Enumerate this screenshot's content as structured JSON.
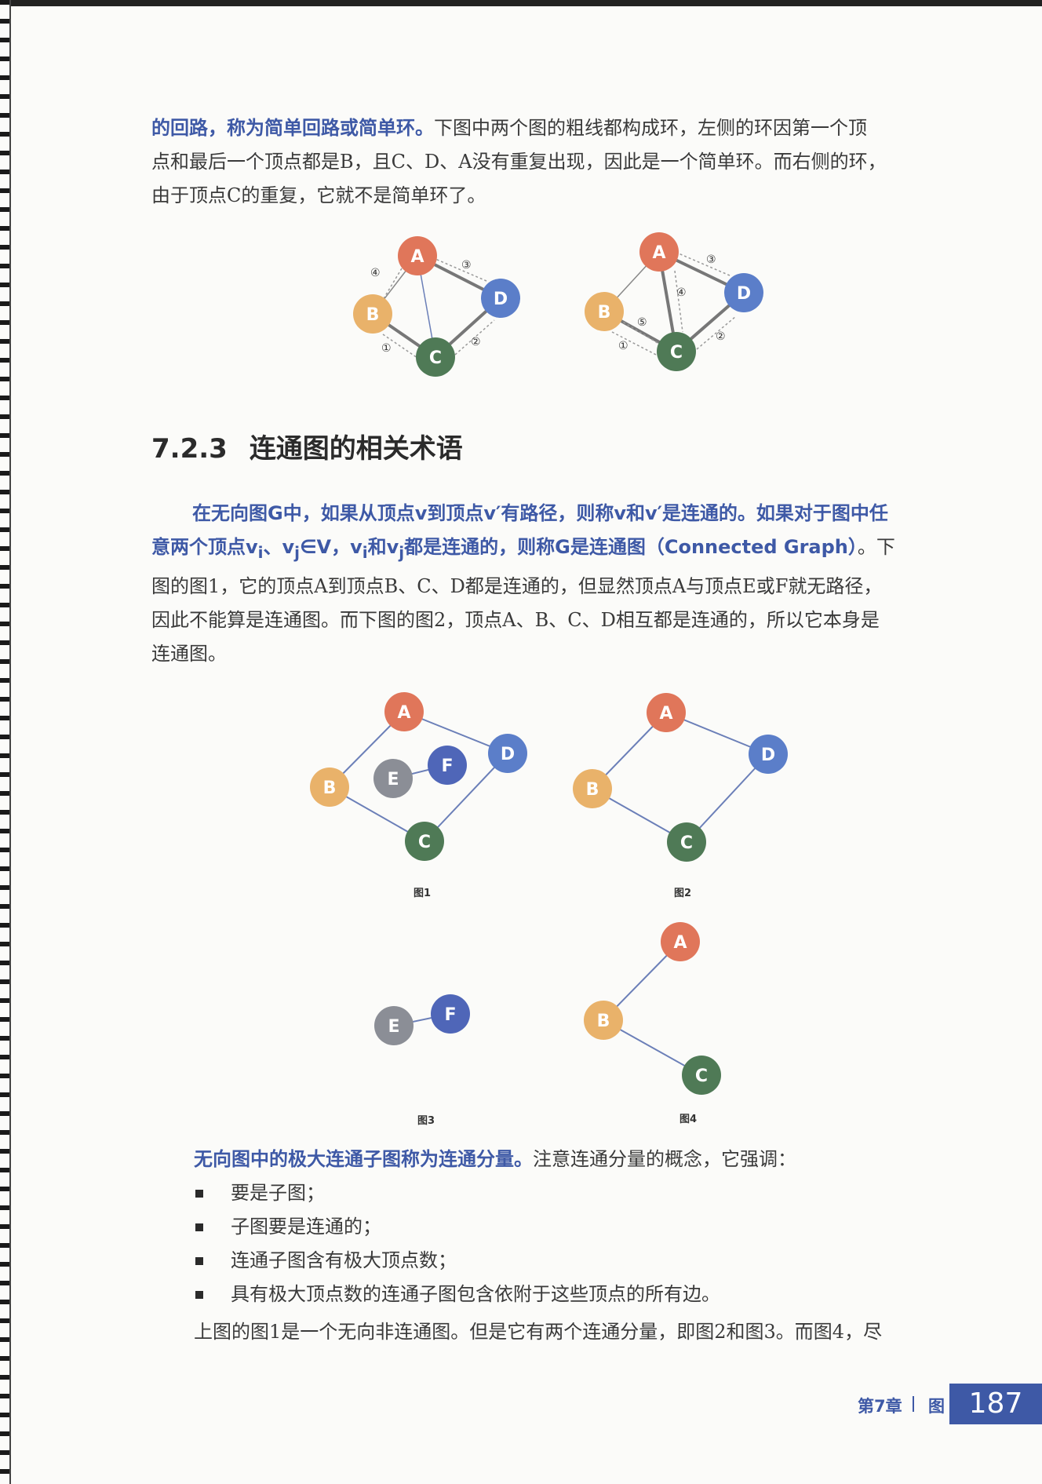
{
  "para1": {
    "line1_highlight": "的回路，称为简单回路或简单环。",
    "line1_rest": "下图中两个图的粗线都构成环，左侧的环因第一个顶",
    "line2": "点和最后一个顶点都是B，且C、D、A没有重复出现，因此是一个简单环。而右侧的环，",
    "line3": "由于顶点C的重复，它就不是简单环了。"
  },
  "section": {
    "number": "7.2.3",
    "title": "连通图的相关术语"
  },
  "para2": {
    "l1": "在无向图G中，如果从顶点v到顶点v′有路径，则称v和v′是连通的。如果对于图中任",
    "l2a": "意两个顶点v",
    "l2b": "、v",
    "l2c": "∈V，v",
    "l2d": "和v",
    "l2e": "都是连通的，则称G是连通图（Connected Graph）",
    "sub_i": "i",
    "sub_j": "j",
    "l2f": "。下",
    "l3": "图的图1，它的顶点A到顶点B、C、D都是连通的，但显然顶点A与顶点E或F就无路径，",
    "l4": "因此不能算是连通图。而下图的图2，顶点A、B、C、D相互都是连通的，所以它本身是",
    "l5": "连通图。"
  },
  "figures": {
    "cycle_left": {
      "nodes": [
        "A",
        "B",
        "C",
        "D"
      ],
      "steps": [
        "④",
        "③",
        "①",
        "②"
      ]
    },
    "cycle_right": {
      "nodes": [
        "A",
        "B",
        "C",
        "D"
      ],
      "steps": [
        "③",
        "④",
        "⑤",
        "①",
        "②"
      ]
    },
    "fig1": {
      "caption": "图1",
      "nodes": [
        "A",
        "B",
        "C",
        "D",
        "E",
        "F"
      ]
    },
    "fig2": {
      "caption": "图2",
      "nodes": [
        "A",
        "B",
        "C",
        "D"
      ]
    },
    "fig3": {
      "caption": "图3",
      "nodes": [
        "E",
        "F"
      ]
    },
    "fig4": {
      "caption": "图4",
      "nodes": [
        "A",
        "B",
        "C"
      ]
    }
  },
  "component": {
    "highlight": "无向图中的极大连通子图称为连通分量。",
    "rest": "注意连通分量的概念，它强调："
  },
  "bullets": [
    "要是子图；",
    "子图要是连通的；",
    "连通子图含有极大顶点数；",
    "具有极大顶点数的连通子图包含依附于这些顶点的所有边。"
  ],
  "tail": "上图的图1是一个无向非连通图。但是它有两个连通分量，即图2和图3。而图4，尽",
  "footer": {
    "chapter": "第7章",
    "title": "图",
    "page": "187"
  },
  "colors": {
    "A": "#e0765a",
    "B": "#e9b26a",
    "C": "#4f7a56",
    "D": "#5b7ec9",
    "E": "#8b8e96",
    "F": "#4f66b8",
    "accent": "#3e59a6"
  }
}
